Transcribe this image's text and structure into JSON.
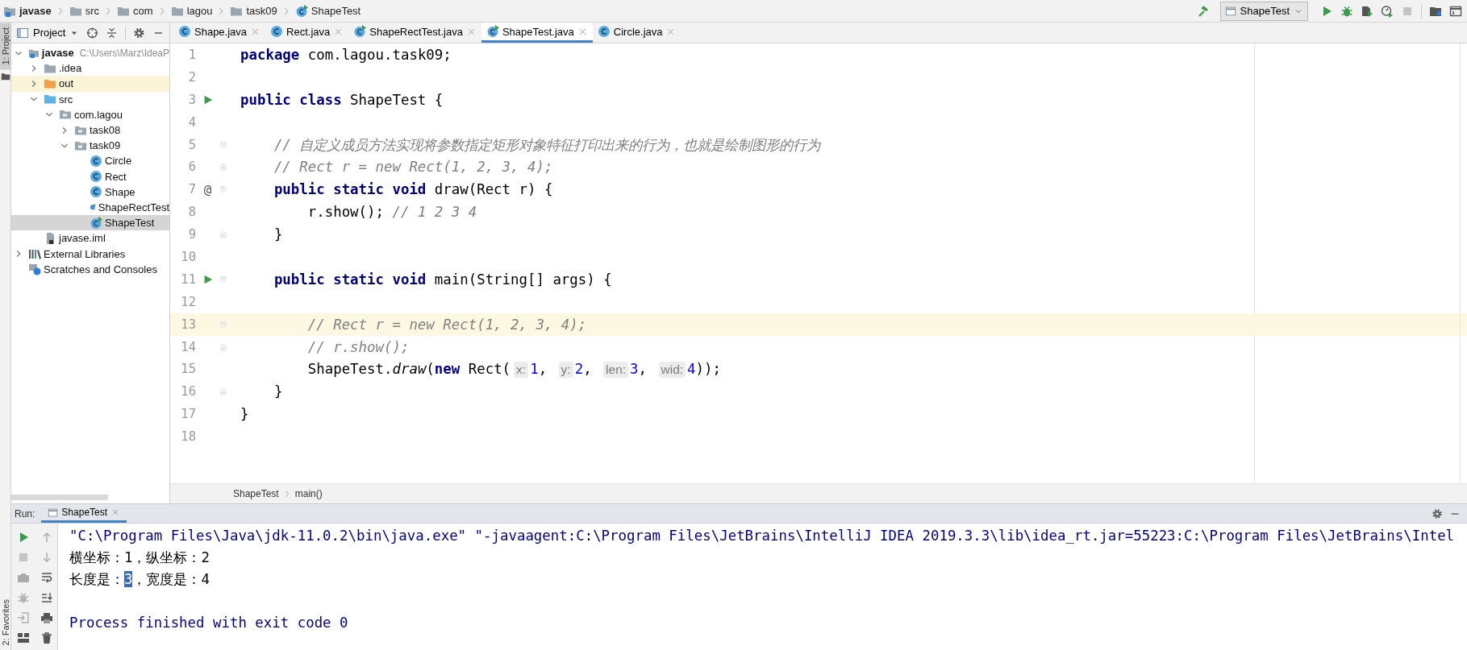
{
  "navbar": {
    "breadcrumbs": [
      {
        "label": "javase",
        "kind": "module"
      },
      {
        "label": "src",
        "kind": "folder"
      },
      {
        "label": "com",
        "kind": "folder"
      },
      {
        "label": "lagou",
        "kind": "folder"
      },
      {
        "label": "task09",
        "kind": "folder"
      },
      {
        "label": "ShapeTest",
        "kind": "runnable_class"
      }
    ],
    "run_config": {
      "label": "ShapeTest"
    }
  },
  "tool_stripe": [
    {
      "label": "1: Project",
      "selected": true
    },
    {
      "label": "2: Favorites",
      "selected": false
    }
  ],
  "project_panel": {
    "title": "Project",
    "tree": [
      {
        "label": "javase",
        "kind": "module",
        "path": "C:\\Users\\Marz\\IdeaP",
        "expanded": true,
        "selected": false,
        "children": [
          {
            "label": ".idea",
            "kind": "folder",
            "expanded": false,
            "selected": false
          },
          {
            "label": "out",
            "kind": "excluded",
            "expanded": false,
            "selected": false
          },
          {
            "label": "src",
            "kind": "source",
            "expanded": true,
            "selected": false,
            "children": [
              {
                "label": "com.lagou",
                "kind": "package",
                "expanded": true,
                "selected": false,
                "children": [
                  {
                    "label": "task08",
                    "kind": "package",
                    "expanded": false,
                    "selected": false
                  },
                  {
                    "label": "task09",
                    "kind": "package",
                    "expanded": true,
                    "selected": false,
                    "children": [
                      {
                        "label": "Circle",
                        "kind": "class",
                        "selected": false
                      },
                      {
                        "label": "Rect",
                        "kind": "class",
                        "selected": false
                      },
                      {
                        "label": "Shape",
                        "kind": "class",
                        "selected": false
                      },
                      {
                        "label": "ShapeRectTest",
                        "kind": "runnable_class",
                        "selected": false
                      },
                      {
                        "label": "ShapeTest",
                        "kind": "runnable_class",
                        "selected": true
                      }
                    ]
                  }
                ]
              }
            ]
          },
          {
            "label": "javase.iml",
            "kind": "file",
            "selected": false
          }
        ]
      },
      {
        "label": "External Libraries",
        "kind": "libraries",
        "expanded": false,
        "selected": false
      },
      {
        "label": "Scratches and Consoles",
        "kind": "scratches",
        "selected": false
      }
    ]
  },
  "editor": {
    "tabs": [
      {
        "label": "Shape.java",
        "kind": "class",
        "selected": false
      },
      {
        "label": "Rect.java",
        "kind": "class",
        "selected": false
      },
      {
        "label": "ShapeRectTest.java",
        "kind": "runnable_class",
        "selected": false
      },
      {
        "label": "ShapeTest.java",
        "kind": "runnable_class",
        "selected": true
      },
      {
        "label": "Circle.java",
        "kind": "class",
        "selected": false
      }
    ],
    "lines": [
      {
        "number": "1",
        "current": false,
        "run_marker": false,
        "fold_start": false,
        "fold_end": false,
        "tokens": [
          {
            "kind": "keyword",
            "text": "package"
          },
          {
            "kind": "plain",
            "text": " com.lagou.task09;"
          }
        ]
      },
      {
        "number": "2",
        "current": false,
        "run_marker": false,
        "fold_start": false,
        "fold_end": false
      },
      {
        "number": "3",
        "current": false,
        "run_marker": true,
        "fold_start": false,
        "fold_end": false,
        "tokens": [
          {
            "kind": "keyword",
            "text": "public class"
          },
          {
            "kind": "plain",
            "text": " ShapeTest {"
          }
        ]
      },
      {
        "number": "4",
        "current": false,
        "run_marker": false,
        "fold_start": false,
        "fold_end": false
      },
      {
        "number": "5",
        "current": false,
        "run_marker": false,
        "fold_start": true,
        "fold_end": false,
        "tokens": [
          {
            "kind": "comment",
            "text": "    // 自定义成员方法实现将参数指定矩形对象特征打印出来的行为，也就是绘制图形的行为"
          }
        ]
      },
      {
        "number": "6",
        "current": false,
        "run_marker": false,
        "fold_start": false,
        "fold_end": true,
        "tokens": [
          {
            "kind": "comment",
            "text": "    // Rect r = new Rect(1, 2, 3, 4);"
          }
        ]
      },
      {
        "number": "7",
        "current": false,
        "run_marker": false,
        "marker_text": "@",
        "fold_start": true,
        "fold_end": false,
        "tokens": [
          {
            "kind": "keyword",
            "text": "    public static void"
          },
          {
            "kind": "plain",
            "text": " draw(Rect r) {"
          }
        ]
      },
      {
        "number": "8",
        "current": false,
        "run_marker": false,
        "fold_start": false,
        "fold_end": false,
        "tokens": [
          {
            "kind": "plain",
            "text": "        r.show(); "
          },
          {
            "kind": "comment",
            "text": "// 1 2 3 4"
          }
        ]
      },
      {
        "number": "9",
        "current": false,
        "run_marker": false,
        "fold_start": false,
        "fold_end": true,
        "tokens": [
          {
            "kind": "plain",
            "text": "    }"
          }
        ]
      },
      {
        "number": "10",
        "current": false,
        "run_marker": false,
        "fold_start": false,
        "fold_end": false
      },
      {
        "number": "11",
        "current": false,
        "run_marker": true,
        "fold_start": true,
        "fold_end": false,
        "tokens": [
          {
            "kind": "keyword",
            "text": "    public static void"
          },
          {
            "kind": "plain",
            "text": " main(String[] args) {"
          }
        ]
      },
      {
        "number": "12",
        "current": false,
        "run_marker": false,
        "fold_start": false,
        "fold_end": false
      },
      {
        "number": "13",
        "current": true,
        "run_marker": false,
        "fold_start": true,
        "fold_end": false,
        "tokens": [
          {
            "kind": "comment",
            "text": "        // Rect r = new Rect(1, 2, 3, 4);"
          }
        ]
      },
      {
        "number": "14",
        "current": false,
        "run_marker": false,
        "fold_start": false,
        "fold_end": true,
        "tokens": [
          {
            "kind": "comment",
            "text": "        // r.show();"
          }
        ]
      },
      {
        "number": "15",
        "current": false,
        "run_marker": false,
        "fold_start": false,
        "fold_end": false,
        "tokens": [
          {
            "kind": "plain",
            "text": "        ShapeTest."
          },
          {
            "kind": "call",
            "text": "draw"
          },
          {
            "kind": "plain",
            "text": "("
          },
          {
            "kind": "keyword",
            "text": "new"
          },
          {
            "kind": "plain",
            "text": " Rect("
          },
          {
            "kind": "hint",
            "text": "x:"
          },
          {
            "kind": "number",
            "text": "1"
          },
          {
            "kind": "plain",
            "text": ", "
          },
          {
            "kind": "hint",
            "text": "y:"
          },
          {
            "kind": "number",
            "text": "2"
          },
          {
            "kind": "plain",
            "text": ", "
          },
          {
            "kind": "hint",
            "text": "len:"
          },
          {
            "kind": "number",
            "text": "3"
          },
          {
            "kind": "plain",
            "text": ", "
          },
          {
            "kind": "hint",
            "text": "wid:"
          },
          {
            "kind": "number",
            "text": "4"
          },
          {
            "kind": "plain",
            "text": "));"
          }
        ]
      },
      {
        "number": "16",
        "current": false,
        "run_marker": false,
        "fold_start": false,
        "fold_end": true,
        "tokens": [
          {
            "kind": "plain",
            "text": "    }"
          }
        ]
      },
      {
        "number": "17",
        "current": false,
        "run_marker": false,
        "fold_start": false,
        "fold_end": false,
        "tokens": [
          {
            "kind": "plain",
            "text": "}"
          }
        ]
      },
      {
        "number": "18",
        "current": false,
        "run_marker": false,
        "fold_start": false,
        "fold_end": false
      }
    ],
    "breadcrumb": [
      "ShapeTest",
      "main()"
    ]
  },
  "run_panel": {
    "title": "Run:",
    "tabs": [
      {
        "label": "ShapeTest",
        "selected": true
      }
    ],
    "console": [
      {
        "kind": "command",
        "parts": [
          {
            "text": "\"C:\\Program Files\\Java\\jdk-11.0.2\\bin\\java.exe\" \"-javaagent:C:\\Program Files\\JetBrains\\IntelliJ IDEA 2019.3.3\\lib\\idea_rt.jar=55223:C:\\Program Files\\JetBrains\\Intel",
            "selected": false
          }
        ]
      },
      {
        "kind": "output",
        "parts": [
          {
            "text": "横坐标：1，纵坐标：2",
            "selected": false
          }
        ]
      },
      {
        "kind": "output",
        "parts": [
          {
            "text": "长度是：",
            "selected": false
          },
          {
            "text": "3",
            "selected": true
          },
          {
            "text": "，宽度是：4",
            "selected": false
          }
        ]
      },
      {
        "kind": "blank"
      },
      {
        "kind": "exit",
        "parts": [
          {
            "text": "Process finished with exit code 0",
            "selected": false
          }
        ]
      }
    ]
  }
}
